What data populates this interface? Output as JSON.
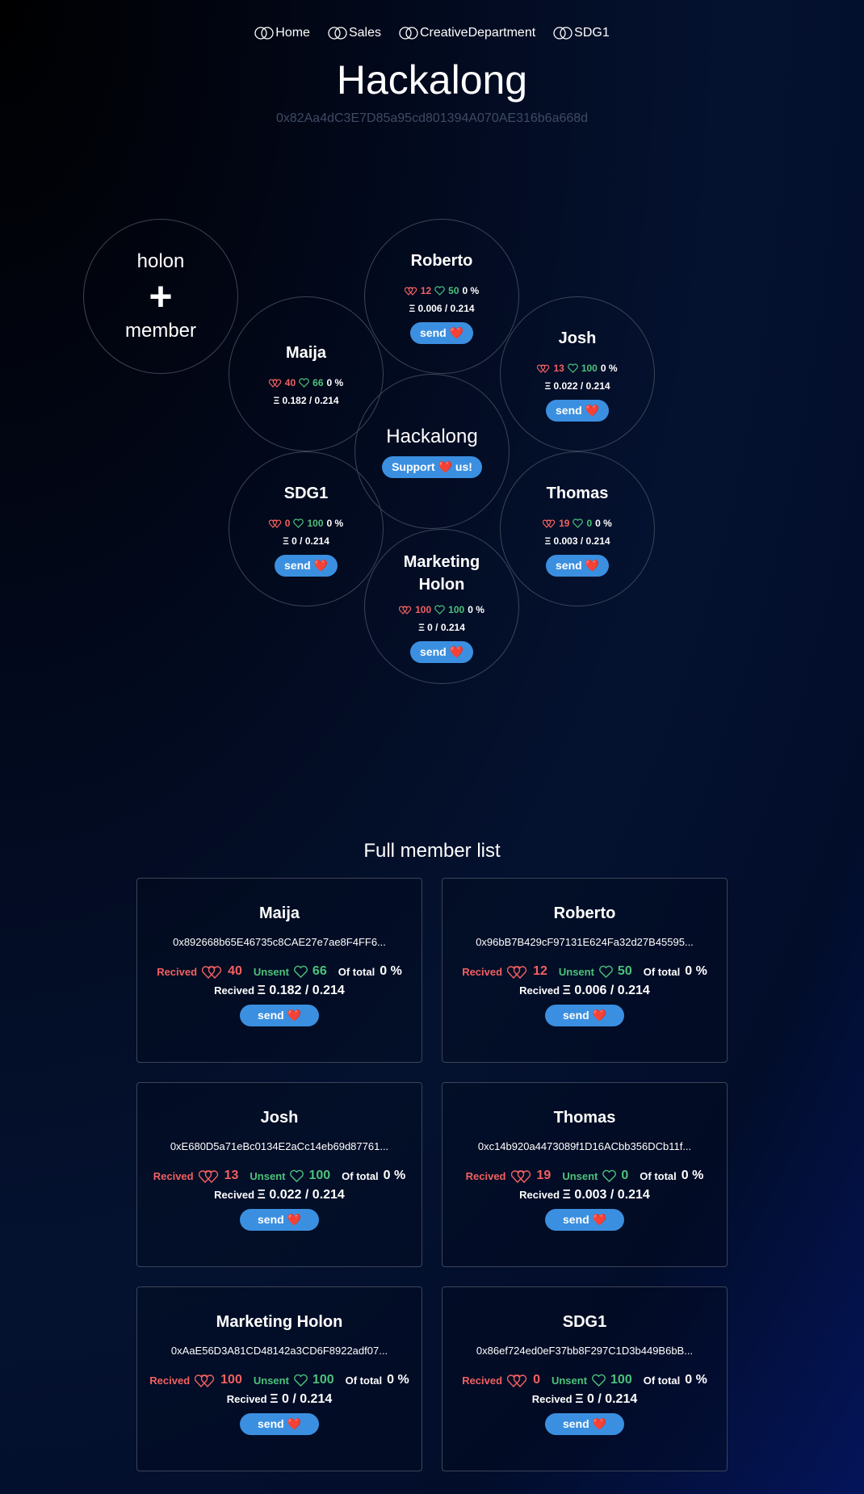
{
  "nav": [
    {
      "label": "Home"
    },
    {
      "label": "Sales"
    },
    {
      "label": "CreativeDepartment"
    },
    {
      "label": "SDG1"
    }
  ],
  "title": "Hackalong",
  "address": "0x82Aa4dC3E7D85a95cd801394A070AE316b6a668d",
  "add_circle": {
    "top": "holon",
    "plus": "+",
    "bottom": "member"
  },
  "center": {
    "name": "Hackalong",
    "button": "Support ❤️ us!"
  },
  "circles": [
    {
      "name": "Roberto",
      "received": "12",
      "unsent": "50",
      "percent": "0 %",
      "eth": "Ξ 0.006 / 0.214",
      "button": "send ❤️"
    },
    {
      "name": "Josh",
      "received": "13",
      "unsent": "100",
      "percent": "0 %",
      "eth": "Ξ 0.022 / 0.214",
      "button": "send ❤️"
    },
    {
      "name": "Maija",
      "received": "40",
      "unsent": "66",
      "percent": "0 %",
      "eth": "Ξ 0.182 / 0.214",
      "button": ""
    },
    {
      "name": "SDG1",
      "received": "0",
      "unsent": "100",
      "percent": "0 %",
      "eth": "Ξ 0 / 0.214",
      "button": "send ❤️"
    },
    {
      "name": "Thomas",
      "received": "19",
      "unsent": "0",
      "percent": "0 %",
      "eth": "Ξ 0.003 / 0.214",
      "button": "send ❤️"
    },
    {
      "name": "Marketing Holon",
      "received": "100",
      "unsent": "100",
      "percent": "0 %",
      "eth": "Ξ 0 / 0.214",
      "button": "send ❤️"
    }
  ],
  "list": {
    "title": "Full member list",
    "received_label": "Recived",
    "unsent_label": "Unsent",
    "total_label": "Of total",
    "eth_label": "Recived",
    "members": [
      {
        "name": "Maija",
        "address": "0x892668b65E46735c8CAE27e7ae8F4FF6...",
        "received": "40",
        "unsent": "66",
        "percent": "0 %",
        "eth": "Ξ 0.182 / 0.214",
        "button": "send ❤️"
      },
      {
        "name": "Roberto",
        "address": "0x96bB7B429cF97131E624Fa32d27B45595...",
        "received": "12",
        "unsent": "50",
        "percent": "0 %",
        "eth": "Ξ 0.006 / 0.214",
        "button": "send ❤️"
      },
      {
        "name": "Josh",
        "address": "0xE680D5a71eBc0134E2aCc14eb69d87761...",
        "received": "13",
        "unsent": "100",
        "percent": "0 %",
        "eth": "Ξ 0.022 / 0.214",
        "button": "send ❤️"
      },
      {
        "name": "Thomas",
        "address": "0xc14b920a4473089f1D16ACbb356DCb11f...",
        "received": "19",
        "unsent": "0",
        "percent": "0 %",
        "eth": "Ξ 0.003 / 0.214",
        "button": "send ❤️"
      },
      {
        "name": "Marketing Holon",
        "address": "0xAaE56D3A81CD48142a3CD6F8922adf07...",
        "received": "100",
        "unsent": "100",
        "percent": "0 %",
        "eth": "Ξ 0 / 0.214",
        "button": "send ❤️"
      },
      {
        "name": "SDG1",
        "address": "0x86ef724ed0eF37bb8F297C1D3b449B6bB...",
        "received": "0",
        "unsent": "100",
        "percent": "0 %",
        "eth": "Ξ 0 / 0.214",
        "button": "send ❤️"
      }
    ]
  },
  "colors": {
    "received": "#f26060",
    "unsent": "#4cc27a",
    "button": "#3b8fe0",
    "border": "#3b4458"
  }
}
